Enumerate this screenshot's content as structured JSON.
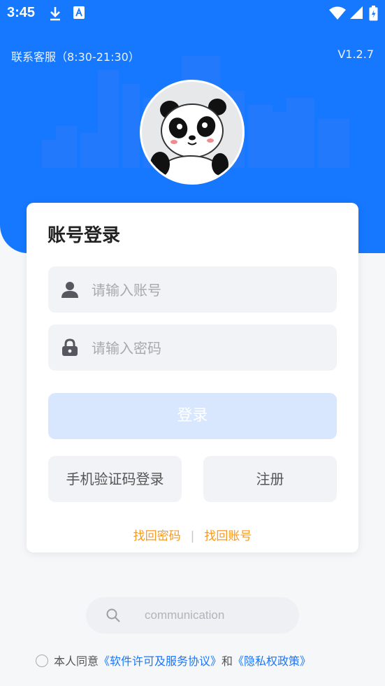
{
  "status_bar": {
    "time": "3:45"
  },
  "header": {
    "service_label": "联系客服（8:30-21:30）",
    "version": "V1.2.7"
  },
  "login_card": {
    "title": "账号登录",
    "account_placeholder": "请输入账号",
    "password_placeholder": "请输入密码",
    "login_button": "登录",
    "sms_login_button": "手机验证码登录",
    "register_button": "注册",
    "find_password": "找回密码",
    "separator": "|",
    "find_account": "找回账号"
  },
  "search": {
    "text": "communication"
  },
  "agreement": {
    "prefix": "本人同意",
    "license_link": "《软件许可及服务协议》",
    "and": "和",
    "privacy_link": "《隐私权政策》"
  },
  "colors": {
    "primary": "#1677ff",
    "login_disabled": "#d8e7fe",
    "link_orange": "#f59a23",
    "field_bg": "#f2f3f6"
  },
  "icons": [
    "download-icon",
    "app-store-icon",
    "wifi-icon",
    "signal-icon",
    "battery-icon",
    "user-icon",
    "lock-icon",
    "search-icon"
  ]
}
